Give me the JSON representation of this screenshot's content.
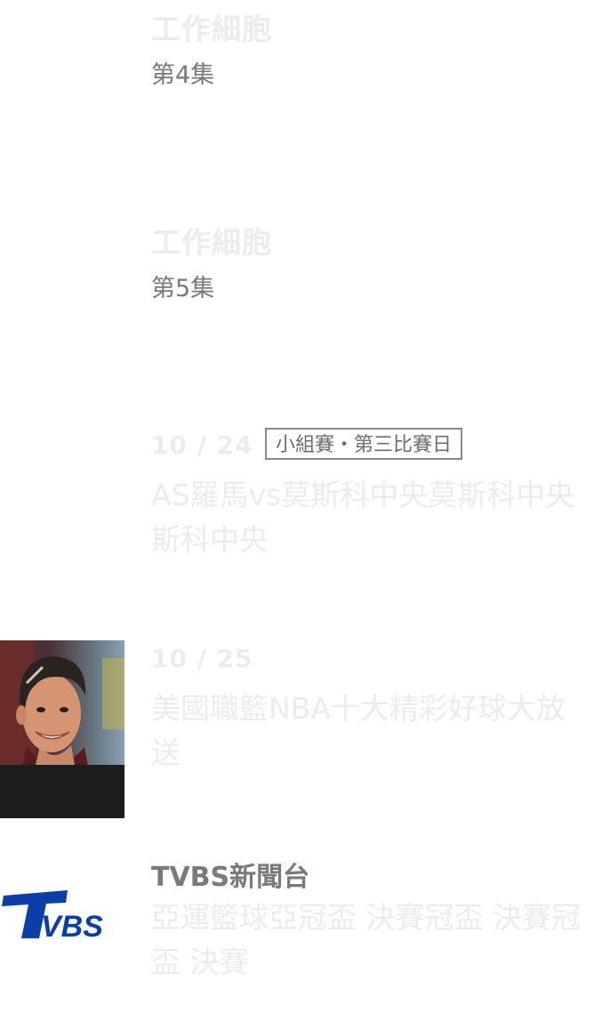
{
  "items": [
    {
      "title": "工作細胞",
      "episode": "第4集"
    },
    {
      "title": "工作細胞",
      "episode": "第5集"
    },
    {
      "date": "10 / 24",
      "tag": "小組賽・第三比賽日",
      "desc": "AS羅馬vs莫斯科中央莫斯科中央斯科中央"
    },
    {
      "date": "10 / 25",
      "desc": "美國職籃NBA十大精彩好球大放送",
      "thumb_icon": "soccer-player-photo"
    },
    {
      "channel": "TVBS新聞台",
      "desc": "亞運籃球亞冠盃 決賽冠盃 決賽冠盃 決賽",
      "logo_text": "TVBS",
      "logo_color": "#0b3ea8"
    }
  ]
}
